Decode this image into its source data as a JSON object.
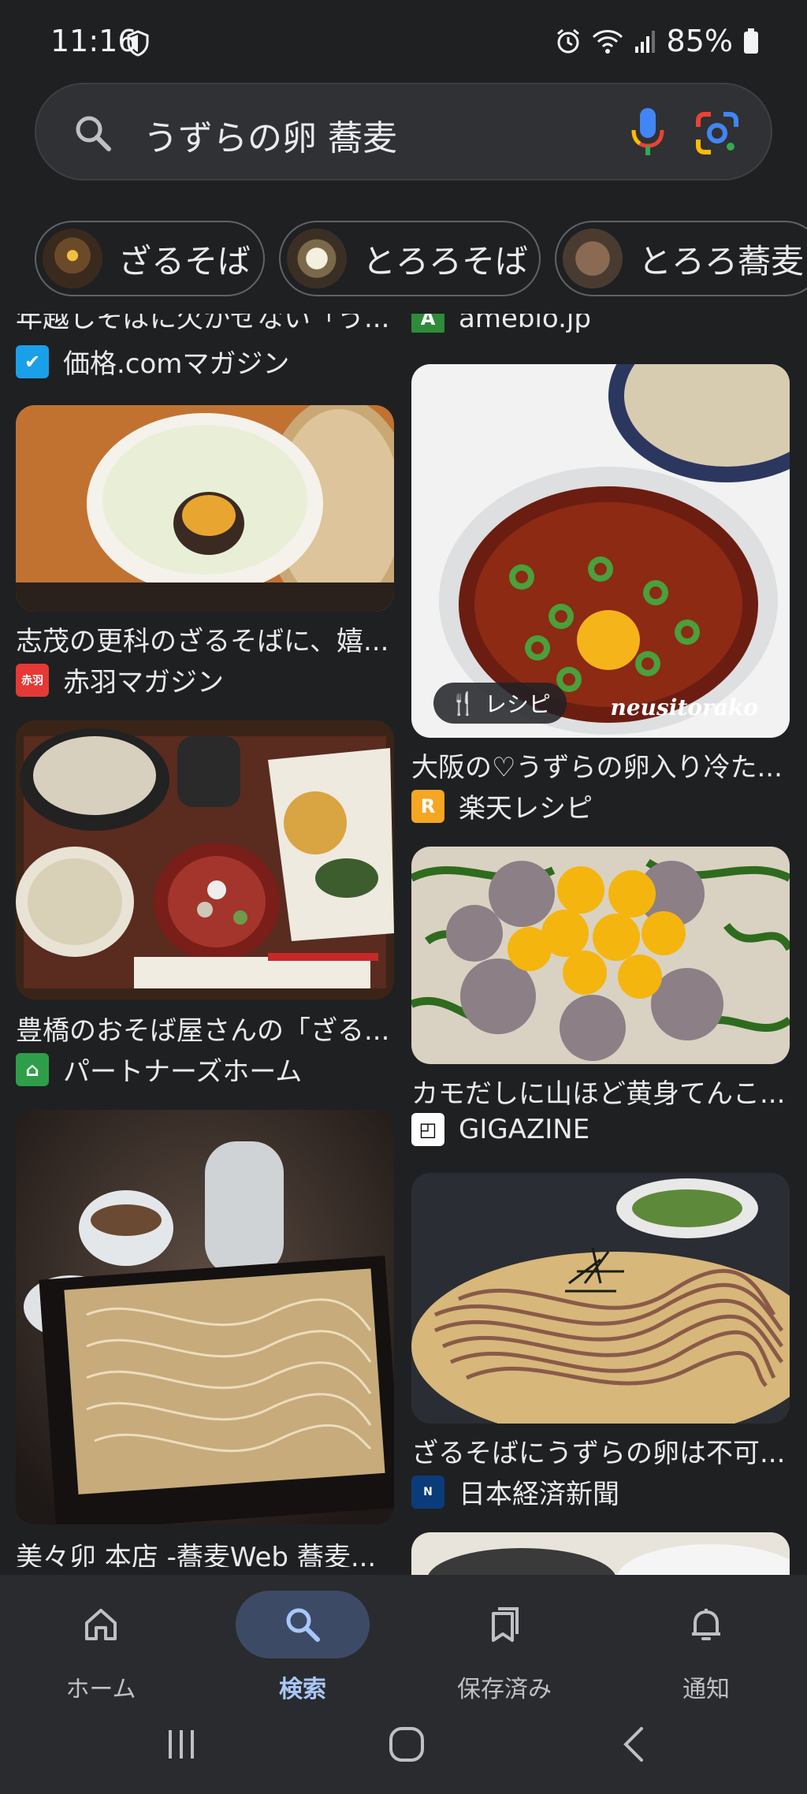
{
  "status_bar": {
    "time": "11:16",
    "battery": "85%"
  },
  "search": {
    "query": "うずらの卵 蕎麦"
  },
  "chips": [
    {
      "label": "ざるそば"
    },
    {
      "label": "とろろそば"
    },
    {
      "label": "とろろ蕎麦"
    }
  ],
  "results_left": [
    {
      "title": "年越しそばに欠かせない「う...",
      "source": "価格.comマガジン"
    },
    {
      "title": "志茂の更科のざるそばに、嬉...",
      "source": "赤羽マガジン"
    },
    {
      "title": "豊橋のおそば屋さんの「ざる...",
      "source": "パートナーズホーム"
    },
    {
      "title": "美々卯 本店 -蕎麦Web 蕎麦..."
    }
  ],
  "results_right": [
    {
      "source": "ameblo.jp"
    },
    {
      "title": "大阪の♡うずらの卵入り冷た...",
      "source": "楽天レシピ",
      "badge": "レシピ",
      "watermark": "neusitorako"
    },
    {
      "title": "カモだしに山ほど黄身てんこ...",
      "source": "GIGAZINE"
    },
    {
      "title": "ざるそばにうずらの卵は不可...",
      "source": "日本経済新聞"
    }
  ],
  "bottom_nav": [
    {
      "label": "ホーム",
      "icon": "home-icon"
    },
    {
      "label": "検索",
      "icon": "search-icon"
    },
    {
      "label": "保存済み",
      "icon": "bookmarks-icon"
    },
    {
      "label": "通知",
      "icon": "bell-icon"
    }
  ]
}
